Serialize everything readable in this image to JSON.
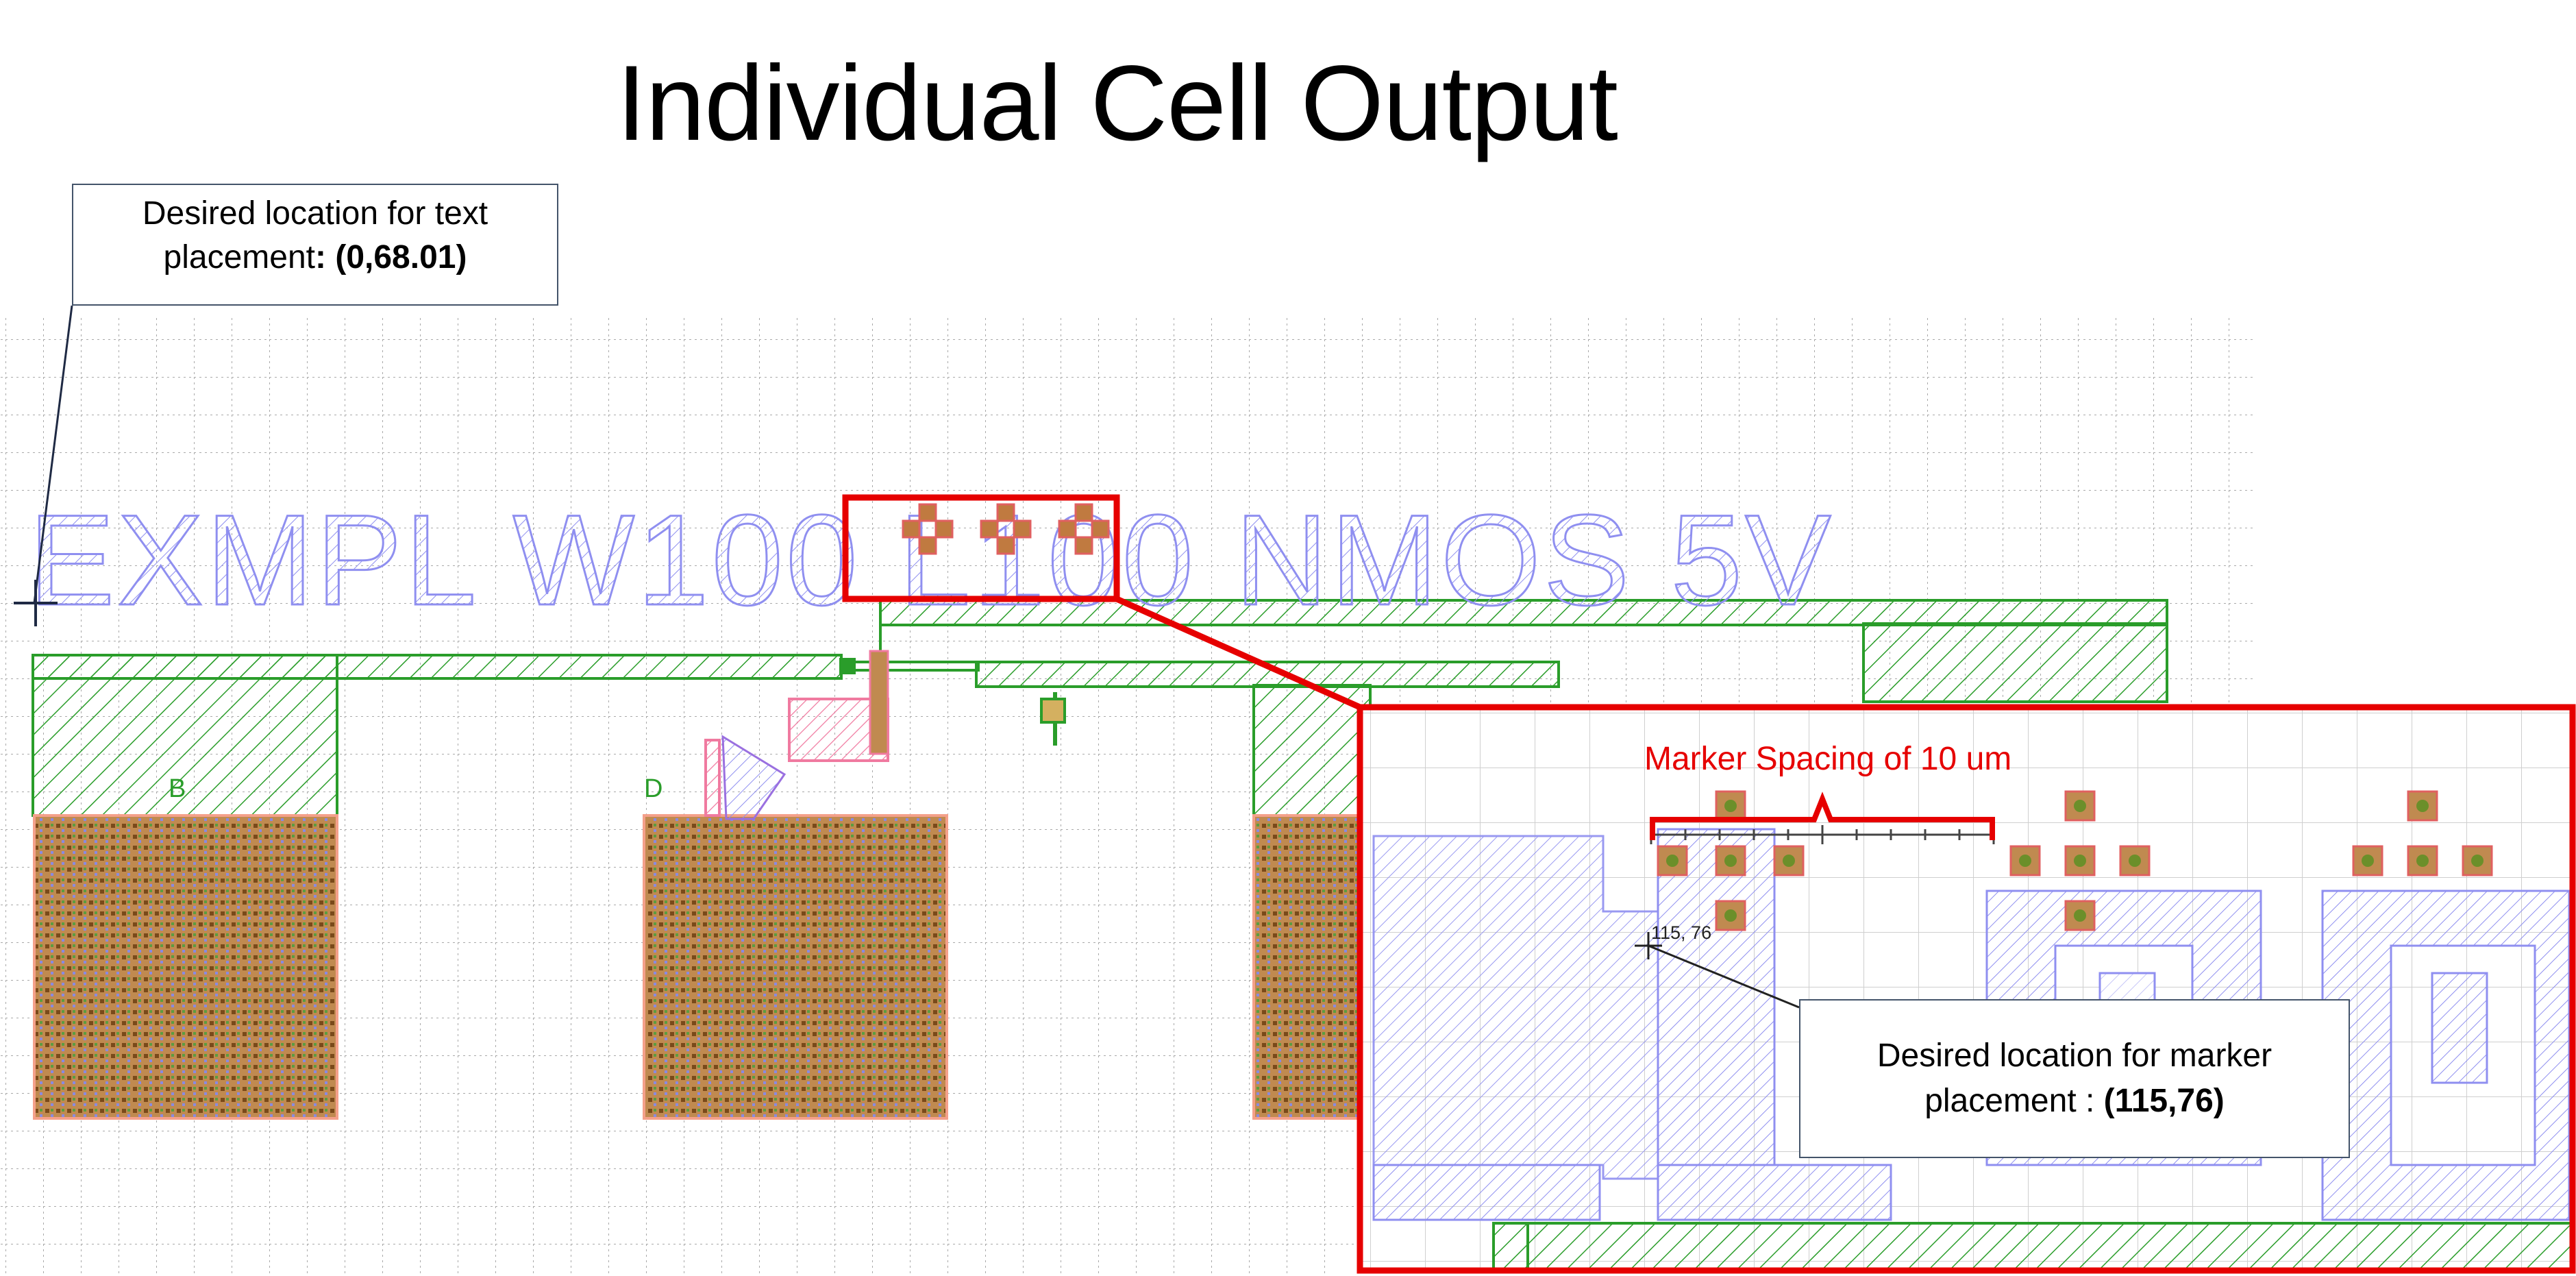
{
  "title": "Individual Cell Output",
  "layout_text": "EXMPL W100 L100 NMOS 5V",
  "pin_labels": [
    "B",
    "D"
  ],
  "callout_text": {
    "line1": "Desired location for text",
    "line2_prefix": "placement",
    "line2_value": ": (0,68.01)"
  },
  "zoom_panel": {
    "marker_spacing_label": "Marker Spacing of 10 um",
    "coordinate_readout": "115, 76",
    "callout_marker": {
      "line1": "Desired location for marker",
      "line2_prefix": "placement : ",
      "line2_value": "(115,76)"
    }
  },
  "colors": {
    "highlight_red": "#e60000",
    "layout_text_purple": "#8f8ff0",
    "metal_green": "#2a9d2a",
    "pad_brown": "#8b5a2b",
    "callout_border": "#44546a",
    "pink_layer": "#f07aa0"
  },
  "icons": [
    "crosshair-icon",
    "crosshair-icon"
  ]
}
